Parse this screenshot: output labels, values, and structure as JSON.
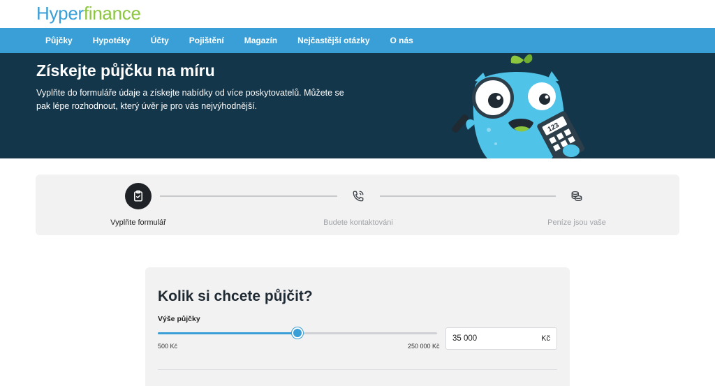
{
  "logo": {
    "part1": "Hyper",
    "part2": "finance"
  },
  "nav": {
    "items": [
      "Půjčky",
      "Hypotéky",
      "Účty",
      "Pojištění",
      "Magazín",
      "Nejčastější otázky",
      "O nás"
    ]
  },
  "hero": {
    "title": "Získejte půjčku na míru",
    "text": "Vyplňte do formuláře údaje a získejte nabídky od více poskytovatelů. Můžete se pak lépe rozhodnout, který úvěr je pro vás nejvýhodnější.",
    "calculator_label": "123"
  },
  "steps": [
    {
      "label": "Vyplňte formulář",
      "icon": "clipboard-check-icon",
      "active": true
    },
    {
      "label": "Budete kontaktováni",
      "icon": "phone-call-icon",
      "active": false
    },
    {
      "label": "Peníze jsou vaše",
      "icon": "coins-icon",
      "active": false
    }
  ],
  "form": {
    "title": "Kolik si chcete půjčit?",
    "field_label": "Výše půjčky",
    "min_label": "500 Kč",
    "max_label": "250 000 Kč",
    "min_value": 500,
    "max_value": 250000,
    "slider_fraction": 0.5,
    "amount_value": "35 000",
    "amount_unit": "Kč"
  },
  "colors": {
    "brand_blue": "#3a9fd6",
    "brand_green": "#8cc63f",
    "hero_bg": "#14364a",
    "panel_bg": "#f2f2f3"
  }
}
